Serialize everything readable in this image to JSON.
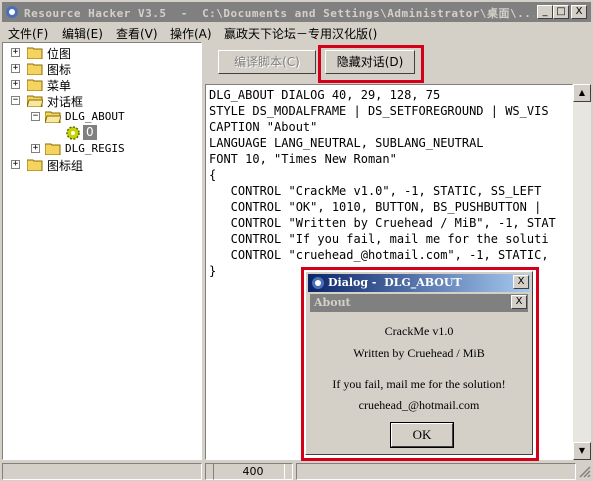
{
  "window": {
    "title": "Resource Hacker V3.5  -  C:\\Documents and Settings\\Administrator\\桌面\\...",
    "minimize_label": "_",
    "maximize_label": "□",
    "close_label": "X"
  },
  "menu": [
    {
      "label": "文件(F)"
    },
    {
      "label": "编辑(E)"
    },
    {
      "label": "查看(V)"
    },
    {
      "label": "操作(A)"
    },
    {
      "label": "赢政天下论坛－专用汉化版()"
    }
  ],
  "tree": {
    "items": [
      {
        "label": "位图",
        "expander": "+"
      },
      {
        "label": "图标",
        "expander": "+"
      },
      {
        "label": "菜单",
        "expander": "+"
      },
      {
        "label": "对话框",
        "expander": "−"
      },
      {
        "label": "DLG_ABOUT",
        "expander": "−"
      },
      {
        "label": "0"
      },
      {
        "label": "DLG_REGIS",
        "expander": "+"
      },
      {
        "label": "图标组",
        "expander": "+"
      }
    ]
  },
  "toolbar": {
    "compile_label": "编译脚本(C)",
    "hide_dialog_label": "隐藏对话(D)"
  },
  "code_lines": [
    "DLG_ABOUT DIALOG 40, 29, 128, 75",
    "STYLE DS_MODALFRAME | DS_SETFOREGROUND | WS_VIS",
    "CAPTION \"About\"",
    "LANGUAGE LANG_NEUTRAL, SUBLANG_NEUTRAL",
    "FONT 10, \"Times New Roman\"",
    "{",
    "   CONTROL \"CrackMe v1.0\", -1, STATIC, SS_LEFT",
    "   CONTROL \"OK\", 1010, BUTTON, BS_PUSHBUTTON | ",
    "   CONTROL \"Written by Cruehead / MiB\", -1, STAT",
    "   CONTROL \"If you fail, mail me for the soluti",
    "   CONTROL \"cruehead_@hotmail.com\", -1, STATIC,",
    "}"
  ],
  "dialog": {
    "title": "Dialog -  DLG_ABOUT",
    "close_label": "X",
    "inner_title": "About",
    "inner_close_label": "X",
    "line1": "CrackMe v1.0",
    "line2": "Written by Cruehead / MiB",
    "line3": "If you fail, mail me for the solution!",
    "line4": "cruehead_@hotmail.com",
    "ok_label": "OK"
  },
  "status": {
    "cell_value": "400"
  },
  "colors": {
    "highlight_border": "#d4001a",
    "title_active": "#0a246a"
  }
}
